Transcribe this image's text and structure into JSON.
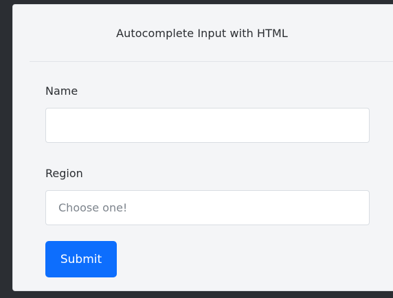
{
  "card": {
    "title": "Autocomplete Input with HTML"
  },
  "form": {
    "name_label": "Name",
    "name_value": "",
    "name_placeholder": "",
    "region_label": "Region",
    "region_value": "",
    "region_placeholder": "Choose one!",
    "submit_label": "Submit"
  },
  "colors": {
    "background": "#2b2e33",
    "card": "#f4f5f7",
    "accent": "#0d6efd"
  }
}
